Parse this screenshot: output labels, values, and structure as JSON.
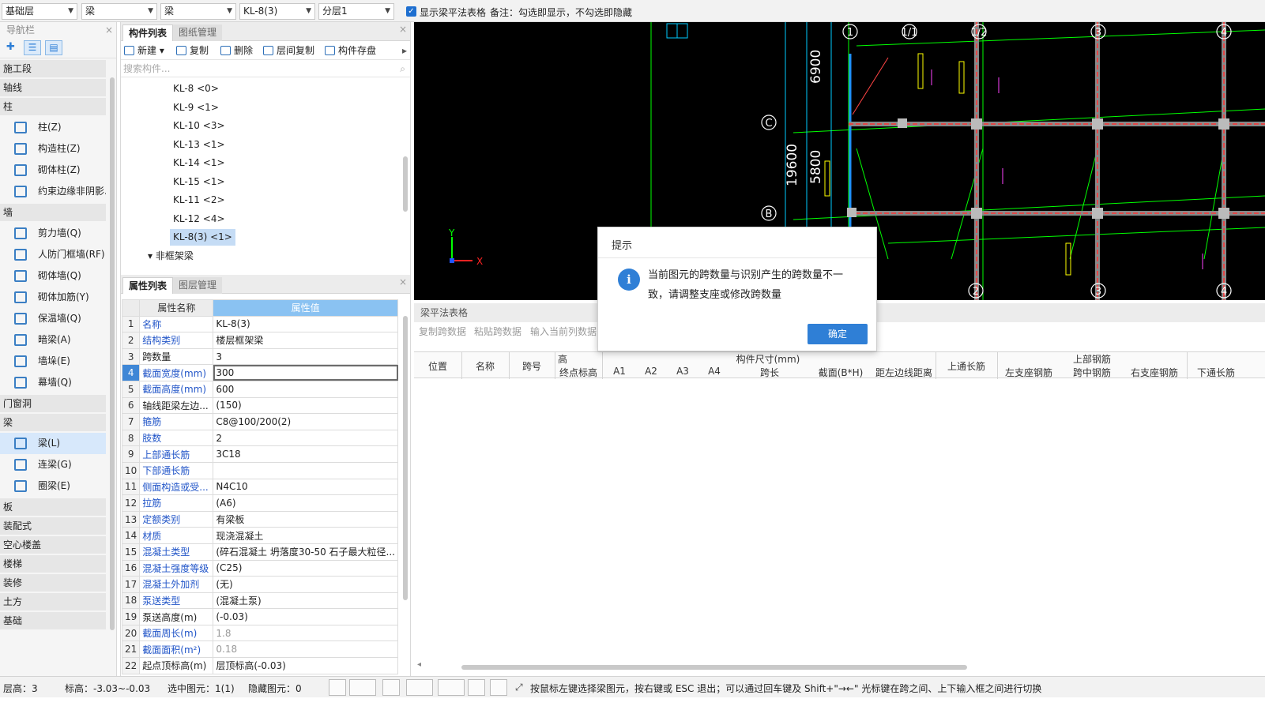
{
  "topbar": {
    "floor": "基础层",
    "category": "梁",
    "type": "梁",
    "component": "KL-8(3)",
    "layer": "分层1",
    "show_table_label": "显示梁平法表格",
    "note": "备注：勾选即显示，不勾选即隐藏"
  },
  "nav": {
    "header": "导航栏",
    "items": [
      {
        "kind": "cat",
        "label": "施工段"
      },
      {
        "kind": "cat",
        "label": "轴线"
      },
      {
        "kind": "cat",
        "label": "柱"
      },
      {
        "kind": "item",
        "label": "柱(Z)",
        "icon": "column-icon"
      },
      {
        "kind": "item",
        "label": "构造柱(Z)",
        "icon": "construct-column-icon"
      },
      {
        "kind": "item",
        "label": "砌体柱(Z)",
        "icon": "masonry-column-icon"
      },
      {
        "kind": "item",
        "label": "约束边缘非阴影...",
        "icon": "edge-constraint-icon"
      },
      {
        "kind": "cat",
        "label": "墙"
      },
      {
        "kind": "item",
        "label": "剪力墙(Q)",
        "icon": "shear-wall-icon"
      },
      {
        "kind": "item",
        "label": "人防门框墙(RF)",
        "icon": "civil-defense-door-wall-icon"
      },
      {
        "kind": "item",
        "label": "砌体墙(Q)",
        "icon": "masonry-wall-icon"
      },
      {
        "kind": "item",
        "label": "砌体加筋(Y)",
        "icon": "masonry-rebar-icon"
      },
      {
        "kind": "item",
        "label": "保温墙(Q)",
        "icon": "insulation-wall-icon"
      },
      {
        "kind": "item",
        "label": "暗梁(A)",
        "icon": "hidden-beam-icon"
      },
      {
        "kind": "item",
        "label": "墙垛(E)",
        "icon": "wall-pier-icon"
      },
      {
        "kind": "item",
        "label": "幕墙(Q)",
        "icon": "curtain-wall-icon"
      },
      {
        "kind": "cat",
        "label": "门窗洞"
      },
      {
        "kind": "cat",
        "label": "梁"
      },
      {
        "kind": "item",
        "label": "梁(L)",
        "icon": "beam-icon",
        "selected": true
      },
      {
        "kind": "item",
        "label": "连梁(G)",
        "icon": "coupling-beam-icon"
      },
      {
        "kind": "item",
        "label": "圈梁(E)",
        "icon": "ring-beam-icon"
      },
      {
        "kind": "cat",
        "label": "板"
      },
      {
        "kind": "cat",
        "label": "装配式"
      },
      {
        "kind": "cat",
        "label": "空心楼盖"
      },
      {
        "kind": "cat",
        "label": "楼梯"
      },
      {
        "kind": "cat",
        "label": "装修"
      },
      {
        "kind": "cat",
        "label": "土方"
      },
      {
        "kind": "cat",
        "label": "基础"
      }
    ]
  },
  "components": {
    "tab_list": "构件列表",
    "tab_drawings": "图纸管理",
    "toolbar": {
      "new": "新建",
      "copy": "复制",
      "delete": "删除",
      "floor_copy": "层间复制",
      "save": "构件存盘"
    },
    "search_placeholder": "搜索构件...",
    "tree": [
      "KL-8 <0>",
      "KL-9 <1>",
      "KL-10 <3>",
      "KL-13 <1>",
      "KL-14 <1>",
      "KL-15 <1>",
      "KL-11 <2>",
      "KL-12 <4>",
      "KL-8(3) <1>"
    ],
    "tree_selected": "KL-8(3) <1>",
    "tree_group": "非框架梁"
  },
  "properties": {
    "tab_list": "属性列表",
    "tab_drawings": "图层管理",
    "col_name": "属性名称",
    "col_value": "属性值",
    "rows": [
      {
        "n": "1",
        "k": "名称",
        "v": "KL-8(3)"
      },
      {
        "n": "2",
        "k": "结构类别",
        "v": "楼层框架梁"
      },
      {
        "n": "3",
        "k": "跨数量",
        "v": "3",
        "black": true
      },
      {
        "n": "4",
        "k": "截面宽度(mm)",
        "v": "300",
        "current": true
      },
      {
        "n": "5",
        "k": "截面高度(mm)",
        "v": "600"
      },
      {
        "n": "6",
        "k": "轴线距梁左边...",
        "v": "(150)",
        "black": true
      },
      {
        "n": "7",
        "k": "箍筋",
        "v": "C8@100/200(2)"
      },
      {
        "n": "8",
        "k": "肢数",
        "v": "2"
      },
      {
        "n": "9",
        "k": "上部通长筋",
        "v": "3C18"
      },
      {
        "n": "10",
        "k": "下部通长筋",
        "v": ""
      },
      {
        "n": "11",
        "k": "侧面构造或受...",
        "v": "N4C10"
      },
      {
        "n": "12",
        "k": "拉筋",
        "v": "(A6)"
      },
      {
        "n": "13",
        "k": "定额类别",
        "v": "有梁板"
      },
      {
        "n": "14",
        "k": "材质",
        "v": "现浇混凝土"
      },
      {
        "n": "15",
        "k": "混凝土类型",
        "v": "(碎石混凝土 坍落度30-50 石子最大粒径..."
      },
      {
        "n": "16",
        "k": "混凝土强度等级",
        "v": "(C25)"
      },
      {
        "n": "17",
        "k": "混凝土外加剂",
        "v": "(无)"
      },
      {
        "n": "18",
        "k": "泵送类型",
        "v": "(混凝土泵)"
      },
      {
        "n": "19",
        "k": "泵送高度(m)",
        "v": "(-0.03)",
        "black": true
      },
      {
        "n": "20",
        "k": "截面周长(m)",
        "v": "1.8",
        "gray": true
      },
      {
        "n": "21",
        "k": "截面面积(m²)",
        "v": "0.18",
        "gray": true
      },
      {
        "n": "22",
        "k": "起点顶标高(m)",
        "v": "层顶标高(-0.03)",
        "black": true
      }
    ]
  },
  "cad": {
    "axis_labels": [
      "1",
      "1/1",
      "1/2",
      "3",
      "4",
      "C",
      "B",
      "2",
      "3",
      "4"
    ],
    "dims": [
      "6900",
      "5800",
      "19600"
    ],
    "xaxis": "X",
    "yaxis": "Y"
  },
  "table": {
    "title": "梁平法表格",
    "actions": [
      "复制跨数据",
      "粘贴跨数据",
      "输入当前列数据"
    ],
    "headers_top": [
      "位置",
      "名称",
      "跨号",
      "高",
      "构件尺寸(mm)",
      "上通长筋",
      "上部钢筋"
    ],
    "headers_sub": [
      "终点标高",
      "A1",
      "A2",
      "A3",
      "A4",
      "跨长",
      "截面(B*H)",
      "距左边线距离",
      "左支座钢筋",
      "跨中钢筋",
      "右支座钢筋",
      "下通长筋"
    ]
  },
  "dialog": {
    "title": "提示",
    "message": "当前图元的跨数量与识别产生的跨数量不一致，请调整支座或修改跨数量",
    "ok": "确定"
  },
  "status": {
    "floor_height": "层高：3",
    "elevation": "标高：-3.03~-0.03",
    "selected": "选中图元：1(1)",
    "hidden": "隐藏图元：0",
    "hint": "按鼠标左键选择梁图元，按右键或 ESC 退出；可以通过回车键及 Shift+\"→←\" 光标键在跨之间、上下输入框之间进行切换"
  },
  "colors": {
    "accent": "#2f7fd6",
    "selected": "#c5dcf5",
    "canvas": "#000000"
  }
}
